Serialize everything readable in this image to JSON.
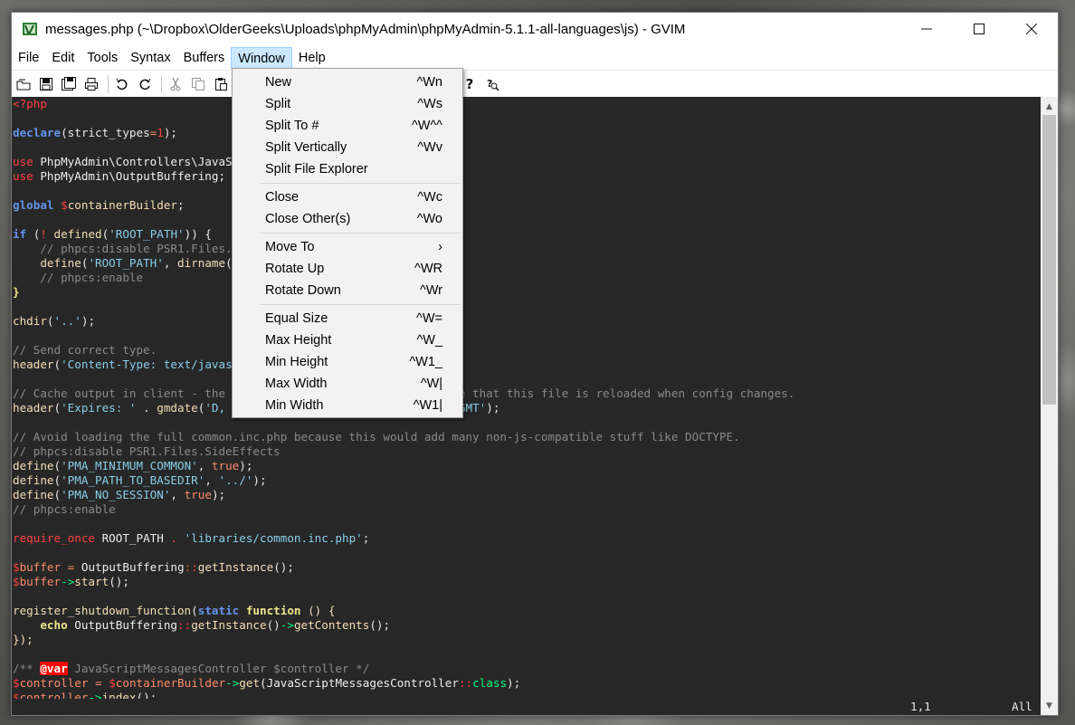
{
  "window": {
    "title": "messages.php (~\\Dropbox\\OlderGeeks\\Uploads\\phpMyAdmin\\phpMyAdmin-5.1.1-all-languages\\js) - GVIM"
  },
  "menubar": {
    "items": [
      "File",
      "Edit",
      "Tools",
      "Syntax",
      "Buffers",
      "Window",
      "Help"
    ],
    "active": "Window"
  },
  "window_menu": {
    "groups": [
      [
        {
          "label": "New",
          "accel": "^Wn"
        },
        {
          "label": "Split",
          "accel": "^Ws"
        },
        {
          "label": "Split To #",
          "accel": "^W^^"
        },
        {
          "label": "Split Vertically",
          "accel": "^Wv"
        },
        {
          "label": "Split File Explorer",
          "accel": ""
        }
      ],
      [
        {
          "label": "Close",
          "accel": "^Wc"
        },
        {
          "label": "Close Other(s)",
          "accel": "^Wo"
        }
      ],
      [
        {
          "label": "Move To",
          "accel": "›"
        },
        {
          "label": "Rotate Up",
          "accel": "^WR"
        },
        {
          "label": "Rotate Down",
          "accel": "^Wr"
        }
      ],
      [
        {
          "label": "Equal Size",
          "accel": "^W="
        },
        {
          "label": "Max Height",
          "accel": "^W_"
        },
        {
          "label": "Min Height",
          "accel": "^W1_"
        },
        {
          "label": "Max Width",
          "accel": "^W|"
        },
        {
          "label": "Min Width",
          "accel": "^W1|"
        }
      ]
    ]
  },
  "toolbar": {
    "icons": [
      "open-icon",
      "save-icon",
      "save-all-icon",
      "print-icon",
      "undo-icon",
      "redo-icon",
      "cut-icon",
      "copy-icon",
      "paste-icon",
      "help-icon",
      "find-help-icon"
    ]
  },
  "code": {
    "lines": [
      [
        [
          "<?php",
          "k-red"
        ]
      ],
      [],
      [
        [
          "declare",
          "k-blue"
        ],
        [
          "(strict_types",
          ""
        ],
        [
          "=",
          "k-op"
        ],
        [
          "1",
          "k-red"
        ],
        [
          ");",
          ""
        ]
      ],
      [],
      [
        [
          "use",
          "k-red"
        ],
        [
          " PhpMyAdmin\\Controllers\\JavaScriptMessagesController;",
          "k-pale"
        ]
      ],
      [
        [
          "use",
          "k-red"
        ],
        [
          " PhpMyAdmin\\OutputBuffering;",
          "k-pale"
        ]
      ],
      [],
      [
        [
          "global",
          "k-blue"
        ],
        [
          " ",
          ""
        ],
        [
          "$",
          "k-red"
        ],
        [
          "containerBuilder",
          "k-fn"
        ],
        [
          ";",
          ""
        ]
      ],
      [],
      [
        [
          "if",
          "k-blue"
        ],
        [
          " (",
          ""
        ],
        [
          "!",
          "k-red"
        ],
        [
          " ",
          ""
        ],
        [
          "defined",
          "k-fn"
        ],
        [
          "(",
          ""
        ],
        [
          "'ROOT_PATH'",
          "k-str"
        ],
        [
          ")) {",
          ""
        ]
      ],
      [
        [
          "    // phpcs:disable PSR1.Files.SideEffects",
          "k-comment"
        ]
      ],
      [
        [
          "    ",
          ""
        ],
        [
          "define",
          "k-fn"
        ],
        [
          "(",
          ""
        ],
        [
          "'ROOT_PATH'",
          "k-str"
        ],
        [
          ", ",
          ""
        ],
        [
          "dirname",
          "k-fn"
        ],
        [
          "(__DIR__) . DIRECTORY_SEPARATOR);",
          ""
        ]
      ],
      [
        [
          "    // phpcs:enable",
          "k-comment"
        ]
      ],
      [
        [
          "}",
          "k-yellow"
        ]
      ],
      [],
      [
        [
          "chdir",
          "k-fn"
        ],
        [
          "(",
          ""
        ],
        [
          "'..'",
          "k-str"
        ],
        [
          ");",
          ""
        ]
      ],
      [],
      [
        [
          "// Send correct type.",
          "k-comment"
        ]
      ],
      [
        [
          "header",
          "k-fn"
        ],
        [
          "(",
          ""
        ],
        [
          "'Content-Type: text/javascript; charset=UTF-8'",
          "k-str"
        ],
        [
          ");",
          ""
        ]
      ],
      [],
      [
        [
          "// Cache output in client - the nocache query parameter makes sure that this file is reloaded when config changes.",
          "k-comment"
        ]
      ],
      [
        [
          "header",
          "k-fn"
        ],
        [
          "(",
          ""
        ],
        [
          "'Expires: '",
          "k-str"
        ],
        [
          " . ",
          ""
        ],
        [
          "gmdate",
          "k-fn"
        ],
        [
          "(",
          ""
        ],
        [
          "'D, d M Y H:i:s'",
          "k-str"
        ],
        [
          ", time() + 3600) . ",
          ""
        ],
        [
          "' GMT'",
          "k-str"
        ],
        [
          ");",
          ""
        ]
      ],
      [],
      [
        [
          "// Avoid loading the full common.inc.php because this would add many non-js-compatible stuff like DOCTYPE.",
          "k-comment"
        ]
      ],
      [
        [
          "// phpcs:disable PSR1.Files.SideEffects",
          "k-comment"
        ]
      ],
      [
        [
          "define",
          "k-fn"
        ],
        [
          "(",
          ""
        ],
        [
          "'PMA_MINIMUM_COMMON'",
          "k-str"
        ],
        [
          ", ",
          ""
        ],
        [
          "true",
          "k-op"
        ],
        [
          ");",
          ""
        ]
      ],
      [
        [
          "define",
          "k-fn"
        ],
        [
          "(",
          ""
        ],
        [
          "'PMA_PATH_TO_BASEDIR'",
          "k-str"
        ],
        [
          ", ",
          ""
        ],
        [
          "'../'",
          "k-str"
        ],
        [
          ");",
          ""
        ]
      ],
      [
        [
          "define",
          "k-fn"
        ],
        [
          "(",
          ""
        ],
        [
          "'PMA_NO_SESSION'",
          "k-str"
        ],
        [
          ", ",
          ""
        ],
        [
          "true",
          "k-op"
        ],
        [
          ");",
          ""
        ]
      ],
      [
        [
          "// phpcs:enable",
          "k-comment"
        ]
      ],
      [],
      [
        [
          "require_once",
          "k-red"
        ],
        [
          " ROOT_PATH ",
          "k-pale"
        ],
        [
          ".",
          "k-red"
        ],
        [
          " ",
          ""
        ],
        [
          "'libraries/common.inc.php'",
          "k-str"
        ],
        [
          ";",
          ""
        ]
      ],
      [],
      [
        [
          "$",
          "k-red"
        ],
        [
          "buffer",
          "k-op"
        ],
        [
          " ",
          ""
        ],
        [
          "=",
          "k-op"
        ],
        [
          " OutputBuffering",
          "k-pale"
        ],
        [
          "::",
          "k-red"
        ],
        [
          "getInstance",
          "k-fn"
        ],
        [
          "();",
          ""
        ]
      ],
      [
        [
          "$",
          "k-red"
        ],
        [
          "buffer",
          "k-op"
        ],
        [
          "->",
          "k-green"
        ],
        [
          "start",
          "k-fn"
        ],
        [
          "();",
          ""
        ]
      ],
      [],
      [
        [
          "register_shutdown_function",
          "k-fn"
        ],
        [
          "(",
          ""
        ],
        [
          "static",
          "k-blue"
        ],
        [
          " ",
          ""
        ],
        [
          "function",
          "k-yellow"
        ],
        [
          " () {",
          "k-fn"
        ]
      ],
      [
        [
          "    ",
          ""
        ],
        [
          "echo",
          "k-yellow"
        ],
        [
          " OutputBuffering",
          "k-pale"
        ],
        [
          "::",
          "k-red"
        ],
        [
          "getInstance",
          "k-fn"
        ],
        [
          "()",
          ""
        ],
        [
          "->",
          "k-green"
        ],
        [
          "getContents",
          "k-fn"
        ],
        [
          "();",
          ""
        ]
      ],
      [
        [
          "});",
          "k-fn"
        ]
      ],
      [],
      [
        [
          "/** ",
          "k-comment"
        ],
        [
          "@var",
          "k-tag2"
        ],
        [
          " JavaScriptMessagesController $controller */",
          "k-comment"
        ]
      ],
      [
        [
          "$",
          "k-red"
        ],
        [
          "controller",
          "k-op"
        ],
        [
          " ",
          ""
        ],
        [
          "=",
          "k-op"
        ],
        [
          " ",
          ""
        ],
        [
          "$",
          "k-red"
        ],
        [
          "containerBuilder",
          "k-op"
        ],
        [
          "->",
          "k-green"
        ],
        [
          "get",
          "k-fn"
        ],
        [
          "(JavaScriptMessagesController",
          "k-pale"
        ],
        [
          "::",
          "k-red"
        ],
        [
          "class",
          "k-green"
        ],
        [
          ");",
          ""
        ]
      ],
      [
        [
          "$",
          "k-red"
        ],
        [
          "controller",
          "k-op"
        ],
        [
          "->",
          "k-green"
        ],
        [
          "index",
          "k-fn"
        ],
        [
          "();",
          ""
        ]
      ]
    ]
  },
  "status": {
    "position": "1,1",
    "scroll": "All"
  }
}
